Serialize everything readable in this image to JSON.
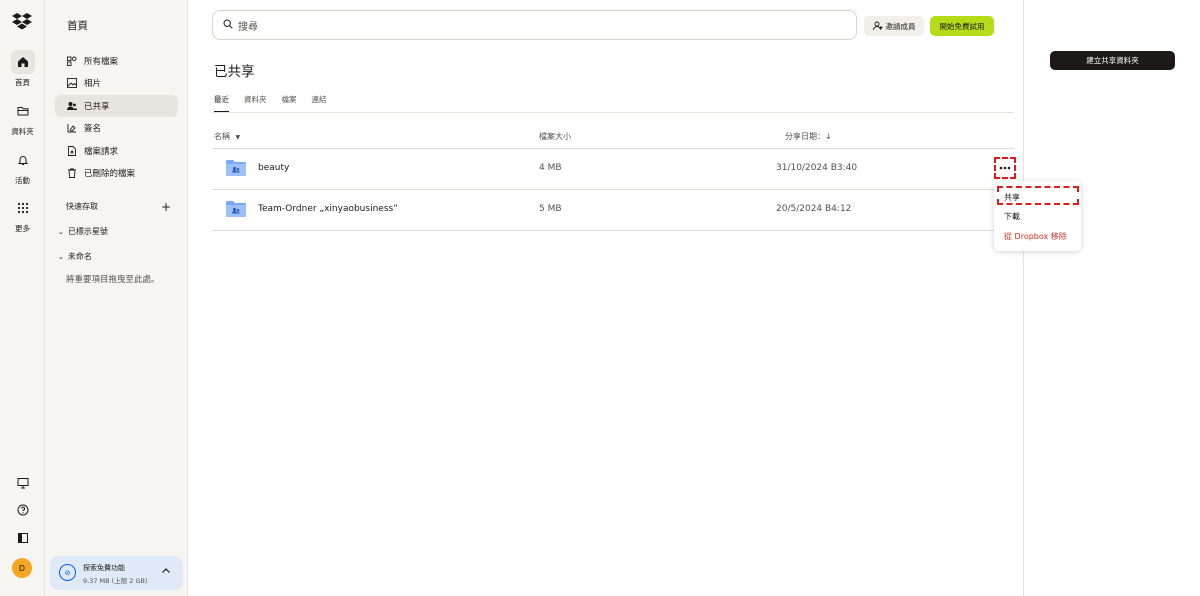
{
  "rail": {
    "items": [
      {
        "label": "首頁",
        "icon": "home-icon"
      },
      {
        "label": "資料夾",
        "icon": "folder-icon"
      },
      {
        "label": "活動",
        "icon": "bell-icon"
      },
      {
        "label": "更多",
        "icon": "grid-icon"
      }
    ],
    "avatar": "D"
  },
  "nav": {
    "title": "首頁",
    "items": [
      {
        "label": "所有檔案",
        "icon": "files-icon"
      },
      {
        "label": "相片",
        "icon": "photo-icon"
      },
      {
        "label": "已共享",
        "icon": "shared-icon"
      },
      {
        "label": "簽名",
        "icon": "signature-icon"
      },
      {
        "label": "檔案請求",
        "icon": "file-request-icon"
      },
      {
        "label": "已刪除的檔案",
        "icon": "trash-icon"
      }
    ],
    "quick_access": "快速存取",
    "starred": "已標示星號",
    "untitled": "未命名",
    "hint": "將重要項目拖曳至此處。",
    "storage_title": "探索免費功能",
    "storage_usage": "9.37 MB (上限 2 GB)"
  },
  "header": {
    "search_placeholder": "搜尋",
    "invite_label": "邀請成員",
    "trial_label": "開始免費試用"
  },
  "main": {
    "title": "已共享",
    "tabs": [
      "最近",
      "資料夾",
      "檔案",
      "連結"
    ],
    "columns": {
      "name": "名稱",
      "size": "檔案大小",
      "date": "分享日期：↓"
    },
    "rows": [
      {
        "name": "beauty",
        "size": "4 MB",
        "date": "31/10/2024 B3:40"
      },
      {
        "name": "Team-Ordner „xinyaobusiness”",
        "size": "5 MB",
        "date": "20/5/2024 B4:12"
      }
    ]
  },
  "menu": {
    "share": "共享",
    "download": "下載",
    "remove": "從 Dropbox 移除"
  },
  "right_panel": {
    "create_label": "建立共享資料夾"
  },
  "colors": {
    "accent": "#0061fe",
    "trial": "#b4dc19",
    "danger": "#d4301f",
    "highlight": "#e01b1b",
    "avatar": "#f5a623"
  }
}
